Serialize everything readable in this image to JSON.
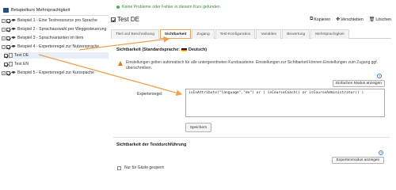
{
  "tree": {
    "title": "Beispielkurs Mehrsprachigkeit",
    "items": [
      {
        "label": "Beispiel 1 - Eine Testressource pro Sprache",
        "toggle": "+"
      },
      {
        "label": "Beispiel 2 - Sprachauswahl per Weggesteuerung",
        "toggle": "+"
      },
      {
        "label": "Beispiel 3 - Sprachvarianten im Item",
        "toggle": "+"
      },
      {
        "label": "Beispiel 4 - Expertenregel zur Nutzersprache",
        "toggle": "−"
      },
      {
        "label": "Test DE"
      },
      {
        "label": "Test EN"
      },
      {
        "label": "Beispiel 5 - Expertenregel zur Kursspache",
        "toggle": "+"
      }
    ]
  },
  "message": "Keine Probleme oder Fehler in diesem Kurs gefunden",
  "page": {
    "title": "Test DE",
    "actions": {
      "copy": "Kopieren",
      "move": "Verschieben",
      "delete": "Löschen"
    }
  },
  "tabs": [
    "Titel und Beschreibung",
    "Sichtbarkeit",
    "Zugang",
    "Test-Konfiguration",
    "Variablen",
    "Bewertung",
    "Mehrsprachigkeit"
  ],
  "visibility": {
    "heading": "Sichtbarkeit (Standardsprache:",
    "heading_lang": "Deutsch)",
    "warning": "Einstellungen gelten automatisch für alle untergeordneten Kursbausteine. Einstellungen zur Sichtbarkeit können Einstellungen zum Zugang ggf. überschreiben.",
    "simple_mode_button": "Einfachen Modus anzeigen",
    "expert_rule_label": "Expertenregel:",
    "expression": "isInAttribute(\"language\",\"de\") or ( isCourseCoach() or isCourseAdministrator() )",
    "save_button": "Speichern",
    "help": "?"
  },
  "execution": {
    "heading": "Sichtbarkeit der Testdurchführung",
    "expert_mode_button": "Expertenmodus anzeigen",
    "guest_only": "Nur für Gäste gesperrt",
    "help": "?"
  },
  "colors": {
    "accent": "#f0a050",
    "success": "#4caf50",
    "warning": "#e07a1f",
    "link": "#3b82c4"
  }
}
